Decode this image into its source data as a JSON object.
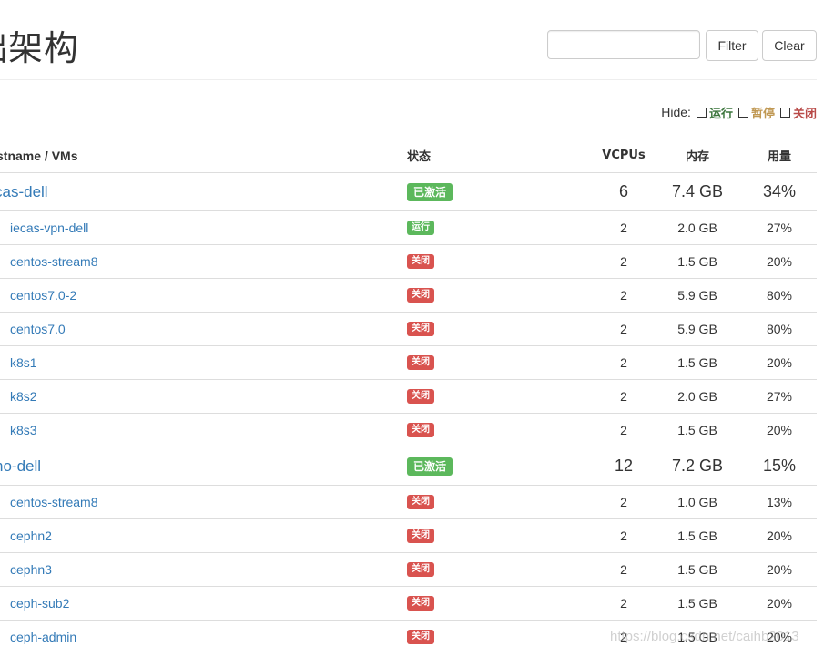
{
  "page": {
    "title": "础架构"
  },
  "filter": {
    "placeholder": "",
    "value": "",
    "filter_label": "Filter",
    "clear_label": "Clear"
  },
  "hide": {
    "label": "Hide:",
    "options": [
      {
        "label": "运行",
        "color": "#3c763d",
        "checked": false
      },
      {
        "label": "暂停",
        "color": "#c09853",
        "checked": false
      },
      {
        "label": "关闭",
        "color": "#b94a48",
        "checked": false
      }
    ]
  },
  "table": {
    "headers": {
      "name": "stname / VMs",
      "state": "状态",
      "vcpus": "VCPUs",
      "memory": "内存",
      "usage": "用量"
    },
    "hosts": [
      {
        "name": "cas-dell",
        "state": "已激活",
        "vcpus": "6",
        "memory": "7.4 GB",
        "usage": "34%",
        "vms": [
          {
            "name": "iecas-vpn-dell",
            "state": "运行",
            "vcpus": "2",
            "memory": "2.0 GB",
            "usage": "27%"
          },
          {
            "name": "centos-stream8",
            "state": "关闭",
            "vcpus": "2",
            "memory": "1.5 GB",
            "usage": "20%"
          },
          {
            "name": "centos7.0-2",
            "state": "关闭",
            "vcpus": "2",
            "memory": "5.9 GB",
            "usage": "80%"
          },
          {
            "name": "centos7.0",
            "state": "关闭",
            "vcpus": "2",
            "memory": "5.9 GB",
            "usage": "80%"
          },
          {
            "name": "k8s1",
            "state": "关闭",
            "vcpus": "2",
            "memory": "1.5 GB",
            "usage": "20%"
          },
          {
            "name": "k8s2",
            "state": "关闭",
            "vcpus": "2",
            "memory": "2.0 GB",
            "usage": "27%"
          },
          {
            "name": "k8s3",
            "state": "关闭",
            "vcpus": "2",
            "memory": "1.5 GB",
            "usage": "20%"
          }
        ]
      },
      {
        "name": "ho-dell",
        "state": "已激活",
        "vcpus": "12",
        "memory": "7.2 GB",
        "usage": "15%",
        "vms": [
          {
            "name": "centos-stream8",
            "state": "关闭",
            "vcpus": "2",
            "memory": "1.0 GB",
            "usage": "13%"
          },
          {
            "name": "cephn2",
            "state": "关闭",
            "vcpus": "2",
            "memory": "1.5 GB",
            "usage": "20%"
          },
          {
            "name": "cephn3",
            "state": "关闭",
            "vcpus": "2",
            "memory": "1.5 GB",
            "usage": "20%"
          },
          {
            "name": "ceph-sub2",
            "state": "关闭",
            "vcpus": "2",
            "memory": "1.5 GB",
            "usage": "20%"
          },
          {
            "name": "ceph-admin",
            "state": "关闭",
            "vcpus": "2",
            "memory": "1.5 GB",
            "usage": "20%"
          }
        ]
      }
    ]
  },
  "watermark": "https://blog.csdn.net/caihb2013"
}
